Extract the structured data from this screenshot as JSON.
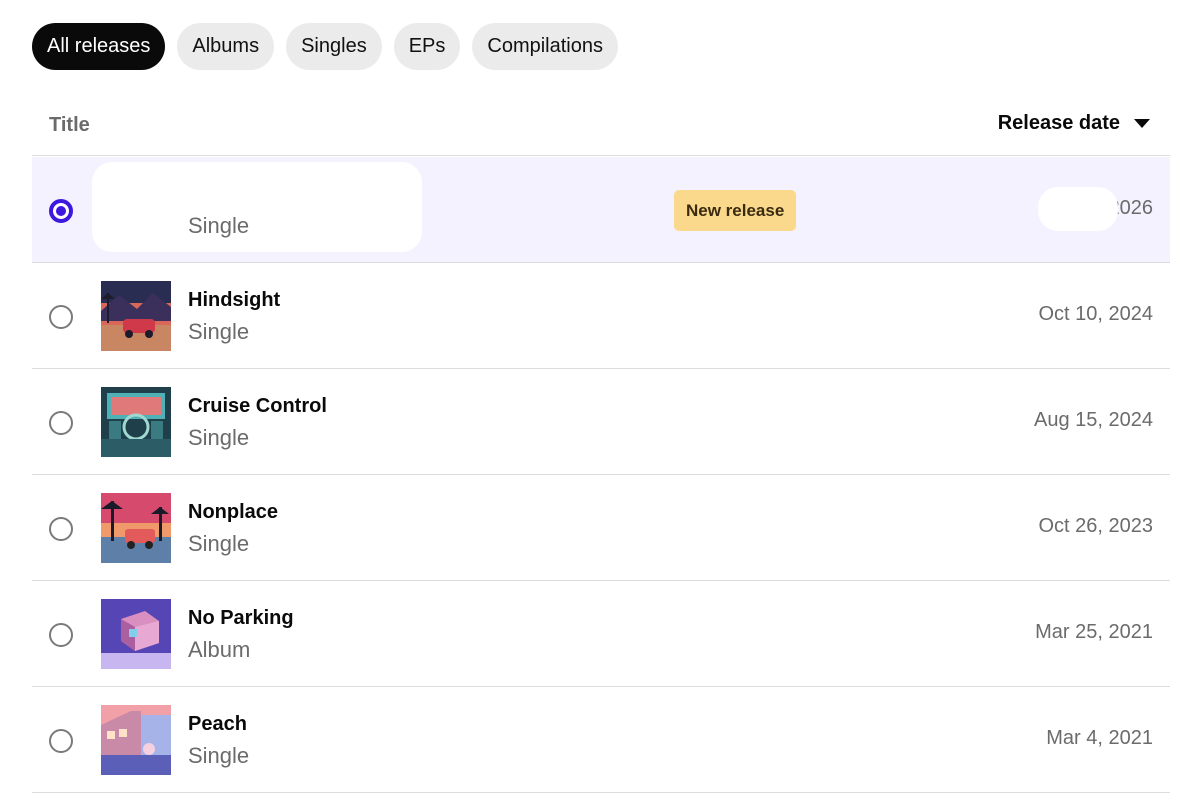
{
  "filters": [
    "All releases",
    "Albums",
    "Singles",
    "EPs",
    "Compilations"
  ],
  "header": {
    "title_label": "Title",
    "date_label": "Release date"
  },
  "badge_text": "New release",
  "releases": [
    {
      "name": "",
      "type": "Single",
      "date": "2026"
    },
    {
      "name": "Hindsight",
      "type": "Single",
      "date": "Oct 10, 2024"
    },
    {
      "name": "Cruise Control",
      "type": "Single",
      "date": "Aug 15, 2024"
    },
    {
      "name": "Nonplace",
      "type": "Single",
      "date": "Oct 26, 2023"
    },
    {
      "name": "No Parking",
      "type": "Album",
      "date": "Mar 25, 2021"
    },
    {
      "name": "Peach",
      "type": "Single",
      "date": "Mar 4, 2021"
    }
  ],
  "colors": {
    "accent": "#3d19e0",
    "badge": "#fbd98c",
    "selected_row": "#f3f2fe"
  }
}
